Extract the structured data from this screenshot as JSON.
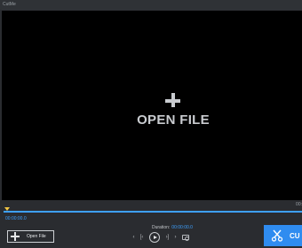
{
  "window": {
    "title": "CutMe"
  },
  "viewport": {
    "open_label": "OPEN FILE"
  },
  "timeline": {
    "start_time": "00:00:00.0",
    "end_time": "00:"
  },
  "toolbar": {
    "open_button_label": "Open File",
    "duration_label": "Duration:",
    "duration_value": "00:00:00.0",
    "controls": [
      "‹",
      "[‹",
      "›]",
      "›"
    ],
    "cut_label": "CU"
  },
  "icons": {
    "add": "plus-icon",
    "play": "play-icon",
    "snapshot": "camera-icon",
    "cut": "scissors-icon"
  },
  "colors": {
    "accent": "#2f8cf0",
    "time_blue": "#3ea0ff",
    "playhead": "#f2c744"
  }
}
